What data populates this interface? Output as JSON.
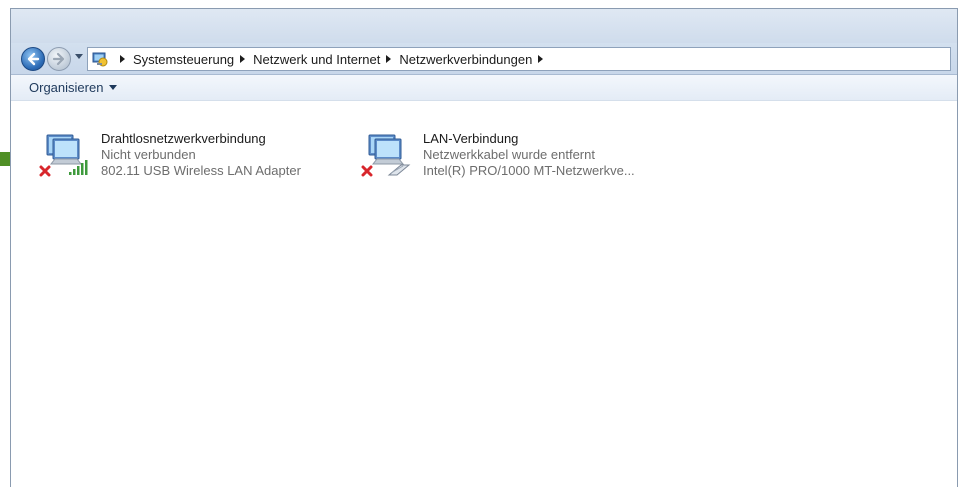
{
  "address": {
    "crumbs": [
      "Systemsteuerung",
      "Netzwerk und Internet",
      "Netzwerkverbindungen"
    ]
  },
  "commandbar": {
    "organize_label": "Organisieren"
  },
  "connections": [
    {
      "name": "Drahtlosnetzwerkverbindung",
      "status": "Nicht verbunden",
      "device": "802.11 USB Wireless LAN Adapter"
    },
    {
      "name": "LAN-Verbindung",
      "status": "Netzwerkkabel wurde entfernt",
      "device": "Intel(R) PRO/1000 MT-Netzwerkve..."
    }
  ],
  "colors": {
    "accent_pointer": "#4f8f26",
    "error_x": "#d8262c",
    "signal_bars": "#3e9a3c"
  }
}
